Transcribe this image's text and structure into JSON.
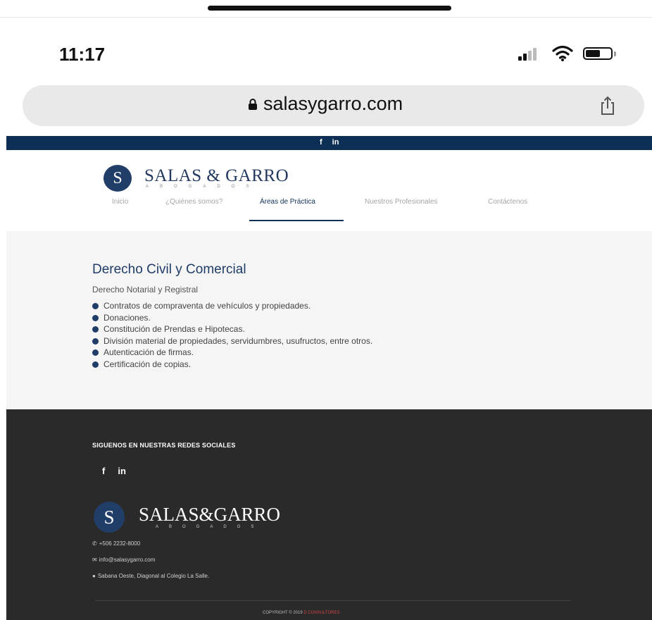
{
  "status_bar": {
    "time": "11:17"
  },
  "browser": {
    "url": "salasygarro.com"
  },
  "site_topbar": {
    "facebook": "f",
    "linkedin": "in"
  },
  "header": {
    "logo_mark": "S",
    "logo_text": "SALAS & GARRO",
    "logo_sub": "ABOGADOS",
    "nav": [
      {
        "label": "Inicio"
      },
      {
        "label": "¿Quiénes somos?"
      },
      {
        "label": "Áreas de Práctica"
      },
      {
        "label": "Nuestros Profesionales"
      },
      {
        "label": "Contáctenos"
      }
    ]
  },
  "content": {
    "title": "Derecho Civil y Comercial",
    "subtitle": "Derecho Notarial y Registral",
    "items": [
      "Contratos de compraventa de vehículos y propiedades.",
      "Donaciones.",
      "Constitución de Prendas e Hipotecas.",
      "División material de propiedades, servidumbres, usufructos, entre otros.",
      "Autenticación de firmas.",
      "Certificación de copias."
    ]
  },
  "footer": {
    "heading": "SIGUENOS EN NUESTRAS REDES SOCIALES",
    "facebook": "f",
    "linkedin": "in",
    "logo_mark": "S",
    "logo_text": "SALAS&GARRO",
    "logo_sub": "ABOGADOS",
    "phone": "+506 2232-8000",
    "email": "info@salasygarro.com",
    "address": "Sabana Oeste, Diagonal al Colegio La Salle.",
    "copyright": "COPYRIGHT © 2019",
    "copyright_accent": "D CONSULTORES"
  },
  "colors": {
    "brand_navy": "#0e2f55",
    "footer_bg": "#2a2a2a",
    "content_bg": "#f5f5f5",
    "accent_red": "#d04545"
  }
}
